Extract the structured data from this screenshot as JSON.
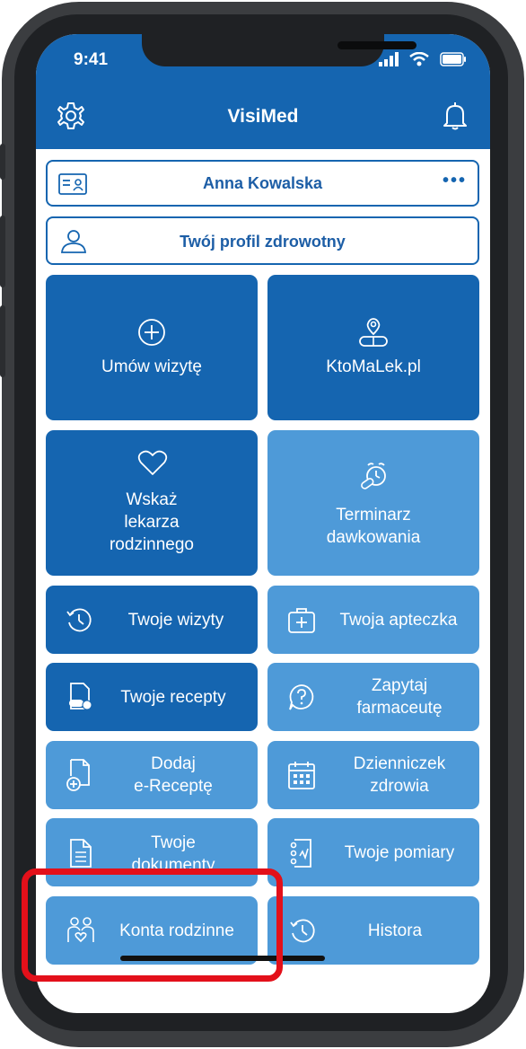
{
  "status_bar": {
    "time": "9:41"
  },
  "header": {
    "title": "VisiMed"
  },
  "profile": {
    "name": "Anna Kowalska",
    "menu_label": "•••"
  },
  "health_profile": {
    "label": "Twój profil zdrowotny"
  },
  "tiles": {
    "umow": "Umów wizytę",
    "ktomalek": "KtoMaLek.pl",
    "wskaz_1": "Wskaż",
    "wskaz_2": "lekarza",
    "wskaz_3": "rodzinnego",
    "terminarz_1": "Terminarz",
    "terminarz_2": "dawkowania",
    "wizyty": "Twoje wizyty",
    "apteczka": "Twoja apteczka",
    "recepty": "Twoje recepty",
    "zapytaj_1": "Zapytaj",
    "zapytaj_2": "farmaceutę",
    "dodaj_1": "Dodaj",
    "dodaj_2": "e-Receptę",
    "dziennik_1": "Dzienniczek",
    "dziennik_2": "zdrowia",
    "dokumenty_1": "Twoje",
    "dokumenty_2": "dokumenty",
    "pomiary": "Twoje pomiary",
    "konta": "Konta rodzinne",
    "historia": "Historа"
  },
  "colors": {
    "primary": "#1565b0",
    "secondary": "#4e9ad8",
    "highlight": "#e3101a"
  }
}
